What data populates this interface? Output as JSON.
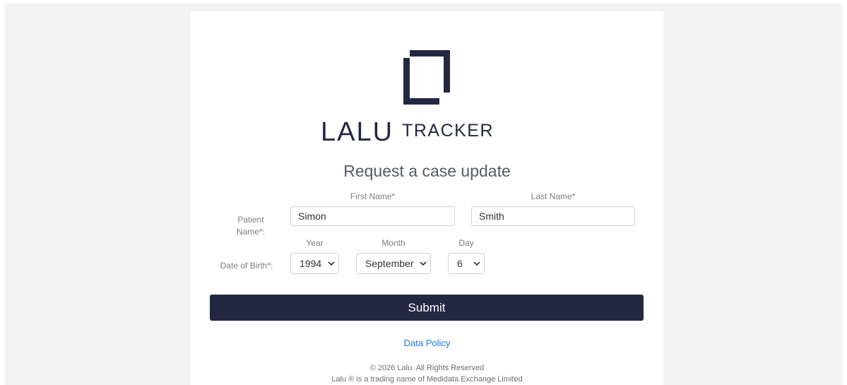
{
  "brand": {
    "name_primary": "LALU",
    "name_secondary": "TRACKER",
    "color": "#232842"
  },
  "heading": "Request a case update",
  "patient_name": {
    "label": "Patient Name*:",
    "first_name_label": "First Name*",
    "first_name_value": "Simon",
    "last_name_label": "Last Name*",
    "last_name_value": "Smith"
  },
  "dob": {
    "label": "Date of Birth*:",
    "year_label": "Year",
    "year_value": "1994",
    "month_label": "Month",
    "month_value": "September",
    "day_label": "Day",
    "day_value": "6"
  },
  "submit_label": "Submit",
  "data_policy_link": "Data Policy",
  "footer": {
    "copyright": "© 2026 Lalu. All Rights Reserved",
    "trading_name": "Lalu ® is a trading name of Medidata Exchange Limited"
  },
  "icons": {
    "logo": "lalu-logo-mark",
    "select_arrow": "chevron-down-icon"
  },
  "colors": {
    "button_bg": "#232842",
    "link": "#1f7ae0",
    "page_bg": "#f3f3f3"
  }
}
